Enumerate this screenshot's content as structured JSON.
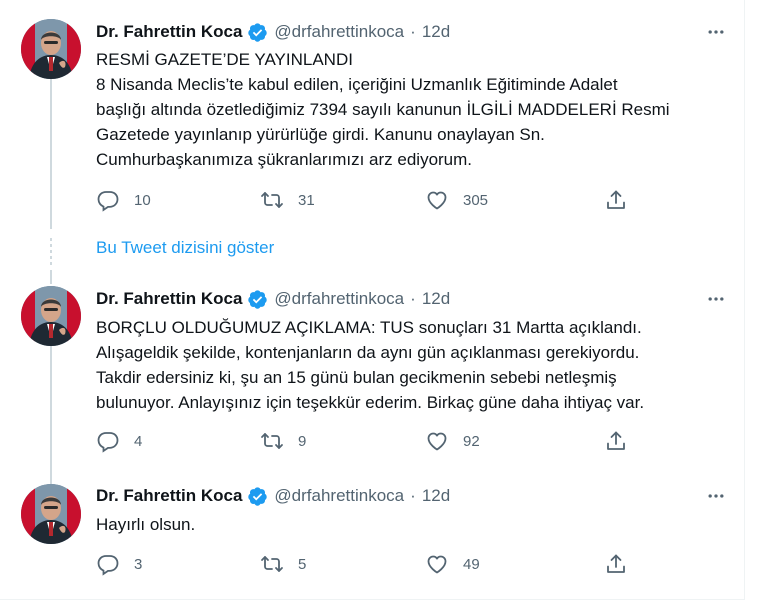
{
  "tweets": [
    {
      "author": {
        "name": "Dr. Fahrettin Koca",
        "handle": "@drfahrettinkoca",
        "verified": true
      },
      "separator": "·",
      "time": "12d",
      "text_lines": [
        "RESMİ GAZETE’DE YAYINLANDI",
        "8 Nisanda Meclis’te kabul edilen, içeriğini Uzmanlık Eğitiminde Adalet",
        "başlığı altında özetlediğimiz 7394 sayılı kanunun İLGİLİ MADDELERİ Resmi",
        "Gazetede yayınlanıp yürürlüğe girdi. Kanunu onaylayan Sn.",
        "Cumhurbaşkanımıza şükranlarımızı arz ediyorum."
      ],
      "stats": {
        "replies": "10",
        "retweets": "31",
        "likes": "305"
      }
    },
    {
      "author": {
        "name": "Dr. Fahrettin Koca",
        "handle": "@drfahrettinkoca",
        "verified": true
      },
      "separator": "·",
      "time": "12d",
      "text_lines": [
        "BORÇLU OLDUĞUMUZ AÇIKLAMA: TUS sonuçları 31 Martta açıklandı.",
        "Alışageldik şekilde, kontenjanların da aynı gün açıklanması gerekiyordu.",
        "Takdir edersiniz ki, şu an 15 günü bulan gecikmenin sebebi netleşmiş",
        "bulunuyor. Anlayışınız için teşekkür ederim. Birkaç güne daha ihtiyaç var."
      ],
      "stats": {
        "replies": "4",
        "retweets": "9",
        "likes": "92"
      }
    },
    {
      "author": {
        "name": "Dr. Fahrettin Koca",
        "handle": "@drfahrettinkoca",
        "verified": true
      },
      "separator": "·",
      "time": "12d",
      "text_lines": [
        "Hayırlı olsun."
      ],
      "stats": {
        "replies": "3",
        "retweets": "5",
        "likes": "49"
      }
    }
  ],
  "show_thread_label": "Bu Tweet dizisini göster",
  "icons": {
    "reply": "speech-bubble-icon",
    "retweet": "retweet-arrows-icon",
    "like": "heart-outline-icon",
    "share": "share-upload-icon",
    "more": "more-dots-icon",
    "verified": "verified-badge-icon"
  },
  "colors": {
    "text": "#0f1419",
    "secondary": "#536471",
    "accent": "#1d9bf0",
    "border": "#eff3f4",
    "thread": "#cfd9de"
  }
}
